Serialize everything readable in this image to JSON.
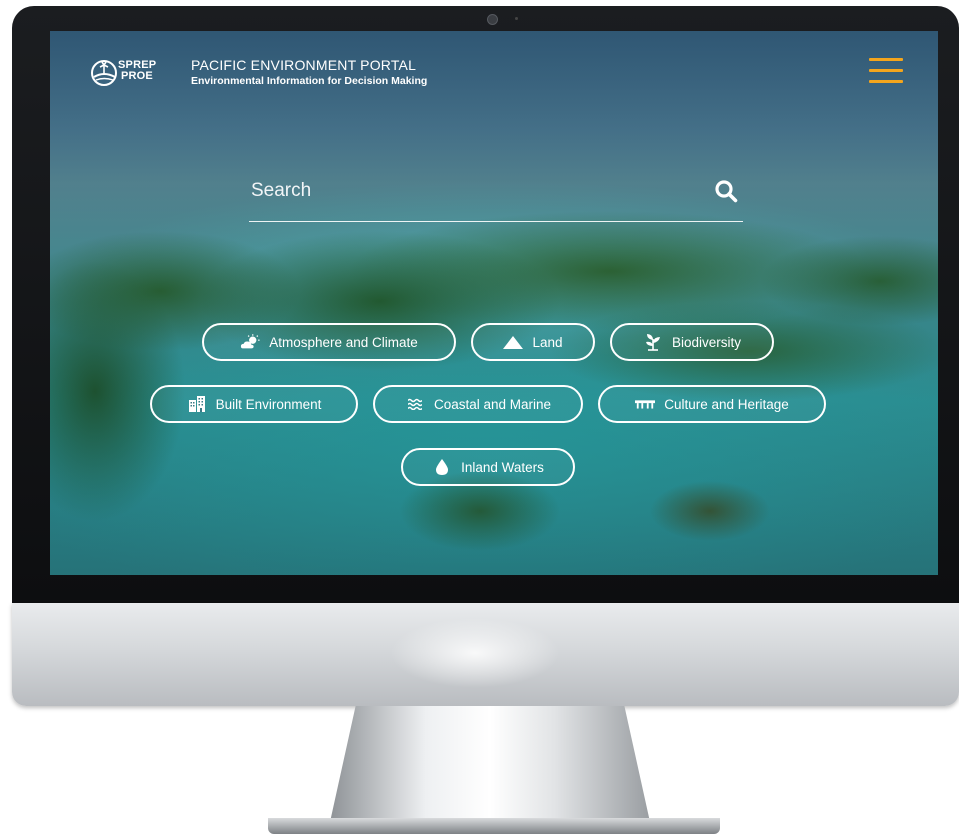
{
  "header": {
    "logo_text_line1": "SPREP",
    "logo_text_line2": "PROE",
    "title": "PACIFIC ENVIRONMENT PORTAL",
    "subtitle": "Environmental Information for Decision Making",
    "menu_icon": "hamburger-menu-icon",
    "accent_color": "#f4a51c"
  },
  "search": {
    "placeholder": "Search",
    "icon": "search-icon"
  },
  "categories": [
    {
      "label": "Atmosphere and Climate",
      "icon": "weather-icon"
    },
    {
      "label": "Land",
      "icon": "mountain-icon"
    },
    {
      "label": "Biodiversity",
      "icon": "plant-icon"
    },
    {
      "label": "Built Environment",
      "icon": "buildings-icon"
    },
    {
      "label": "Coastal and Marine",
      "icon": "waves-icon"
    },
    {
      "label": "Culture and Heritage",
      "icon": "heritage-icon"
    },
    {
      "label": "Inland Waters",
      "icon": "water-drop-icon"
    }
  ]
}
